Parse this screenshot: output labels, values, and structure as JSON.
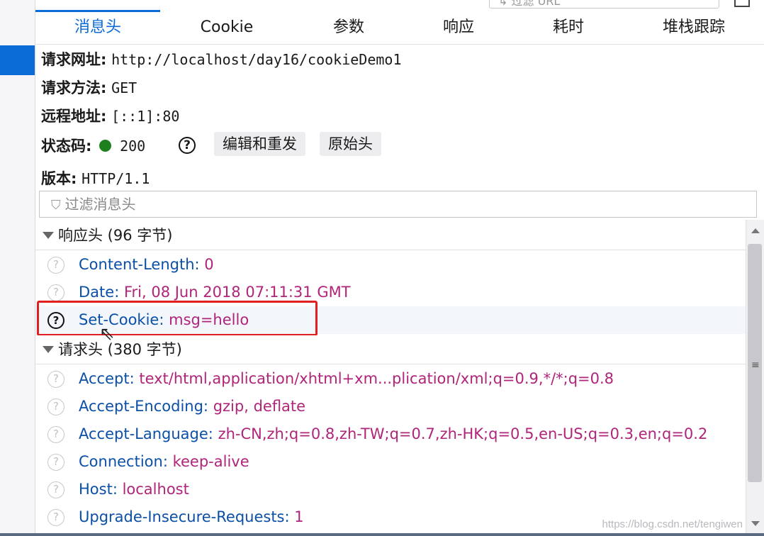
{
  "top": {
    "filter_placeholder": "↳ 过滤 URL"
  },
  "tabs": [
    {
      "label": "消息头",
      "active": true
    },
    {
      "label": "Cookie"
    },
    {
      "label": "参数"
    },
    {
      "label": "响应"
    },
    {
      "label": "耗时"
    },
    {
      "label": "堆栈跟踪"
    }
  ],
  "summary": {
    "url_label": "请求网址:",
    "url_value": "http://localhost/day16/cookieDemo1",
    "method_label": "请求方法:",
    "method_value": "GET",
    "remote_label": "远程地址:",
    "remote_value": "[::1]:80",
    "status_label": "状态码:",
    "status_value": "200",
    "status_color": "#1e7f1e",
    "help_glyph": "?",
    "edit_resend": "编辑和重发",
    "raw_headers": "原始头",
    "version_label": "版本:",
    "version_value": "HTTP/1.1"
  },
  "filter": {
    "icon": "funnel-icon",
    "placeholder": "过滤消息头"
  },
  "response_headers": {
    "title": "响应头 (96 字节)",
    "rows": [
      {
        "name": "Content-Length:",
        "value": "0"
      },
      {
        "name": "Date:",
        "value": "Fri, 08 Jun 2018 07:11:31 GMT"
      },
      {
        "name": "Set-Cookie:",
        "value": "msg=hello"
      }
    ]
  },
  "request_headers": {
    "title": "请求头 (380 字节)",
    "rows": [
      {
        "name": "Accept:",
        "value": "text/html,application/xhtml+xm...plication/xml;q=0.9,*/*;q=0.8"
      },
      {
        "name": "Accept-Encoding:",
        "value": "gzip, deflate"
      },
      {
        "name": "Accept-Language:",
        "value": "zh-CN,zh;q=0.8,zh-TW;q=0.7,zh-HK;q=0.5,en-US;q=0.3,en;q=0.2"
      },
      {
        "name": "Connection:",
        "value": "keep-alive"
      },
      {
        "name": "Host:",
        "value": "localhost"
      },
      {
        "name": "Upgrade-Insecure-Requests:",
        "value": "1"
      }
    ]
  },
  "watermark": "https://blog.csdn.net/tengiwen",
  "colors": {
    "accent": "#0a6ad6",
    "header_name": "#0a4fa8",
    "header_value": "#b0247a",
    "highlight_box": "#e02020"
  }
}
